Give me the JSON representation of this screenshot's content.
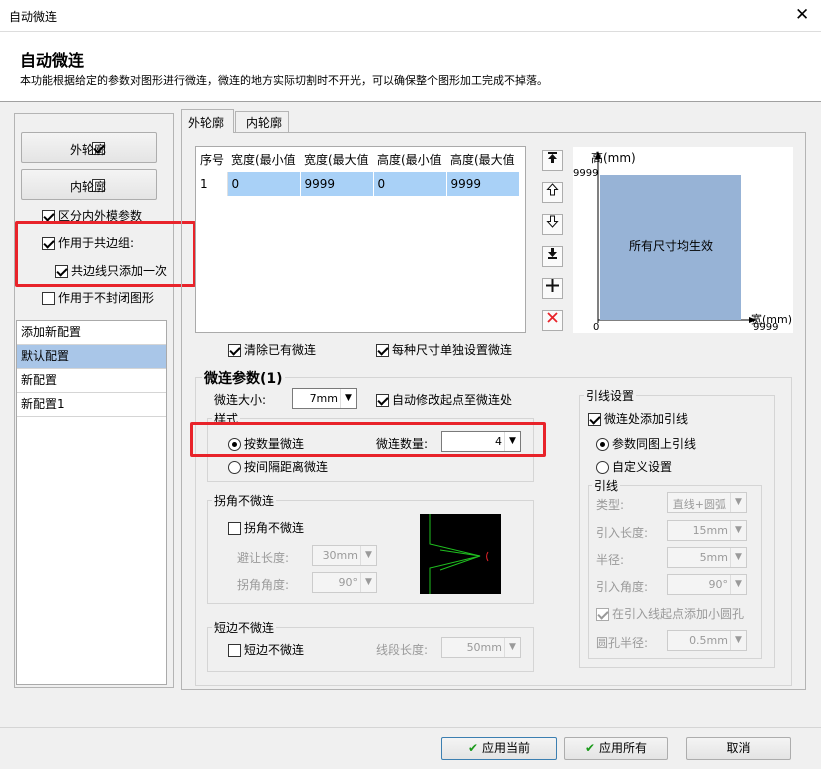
{
  "window": {
    "title": "自动微连",
    "close": "✕"
  },
  "header": {
    "title": "自动微连",
    "description": "本功能根据给定的参数对图形进行微连，微连的地方实际切割时不开光，可以确保整个图形加工完成不掉落。"
  },
  "left": {
    "outer_btn": "外轮廓",
    "inner_btn": "内轮廓",
    "chk_distinguish": "区分内外模参数",
    "chk_shared": "作用于共边组:",
    "chk_shared_once": "共边线只添加一次",
    "chk_unclosed": "作用于不封闭图形",
    "configs": [
      "添加新配置",
      "默认配置",
      "新配置",
      "新配置1"
    ]
  },
  "tabs": [
    "外轮廓",
    "内轮廓"
  ],
  "table": {
    "headers": [
      "序号",
      "宽度(最小值",
      "宽度(最大值",
      "高度(最小值",
      "高度(最大值"
    ],
    "rows": [
      [
        "1",
        "0",
        "9999",
        "0",
        "9999"
      ]
    ]
  },
  "preview": {
    "y_label": "高(mm)",
    "y_max": "9999",
    "x_label": "宽(mm)",
    "x_max": "9999",
    "origin": "0",
    "center": "所有尺寸均生效"
  },
  "opts": {
    "clear": "清除已有微连",
    "per_size": "每种尺寸单独设置微连"
  },
  "params": {
    "title": "微连参数(1)",
    "size_label": "微连大小:",
    "size_value": "7mm",
    "auto_modify": "自动修改起点至微连处",
    "style_label": "样式",
    "by_count": "按数量微连",
    "count_label": "微连数量:",
    "count_value": "4",
    "by_distance": "按间隔距离微连",
    "corner_group": "拐角不微连",
    "corner_chk": "拐角不微连",
    "avoid_len_label": "避让长度:",
    "avoid_len_value": "30mm",
    "corner_angle_label": "拐角角度:",
    "corner_angle_value": "90°",
    "short_group": "短边不微连",
    "short_chk": "短边不微连",
    "seg_len_label": "线段长度:",
    "seg_len_value": "50mm"
  },
  "lead": {
    "group": "引线设置",
    "add_lead": "微连处添加引线",
    "same_as_fig": "参数同图上引线",
    "custom": "自定义设置",
    "sub_group": "引线",
    "type_label": "类型:",
    "type_value": "直线+圆弧",
    "len_label": "引入长度:",
    "len_value": "15mm",
    "radius_label": "半径:",
    "radius_value": "5mm",
    "angle_label": "引入角度:",
    "angle_value": "90°",
    "hole_chk": "在引入线起点添加小圆孔",
    "hole_r_label": "圆孔半径:",
    "hole_r_value": "0.5mm"
  },
  "footer": {
    "apply_current": "应用当前",
    "apply_all": "应用所有",
    "cancel": "取消"
  },
  "colors": {
    "accent": "#e8232a",
    "selection": "#a9c6e8",
    "preview_fill": "#97b3d6"
  }
}
